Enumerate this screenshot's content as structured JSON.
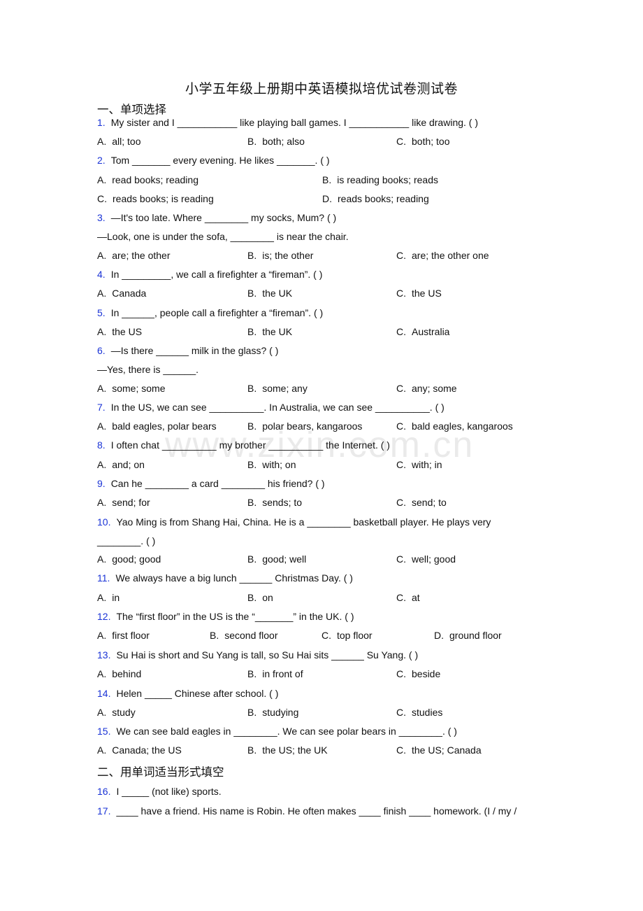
{
  "title": "小学五年级上册期中英语模拟培优试卷测试卷",
  "watermark": "www.zixin.com.cn",
  "sections": [
    {
      "heading": "一、单项选择"
    },
    {
      "heading": "二、用单词适当形式填空"
    }
  ],
  "questions": [
    {
      "num": "1.",
      "lines": [
        "My sister and I ___________ like playing ball games. I ___________ like drawing. (    )"
      ],
      "options": [
        {
          "label": "A.",
          "text": "all; too"
        },
        {
          "label": "B.",
          "text": "both; also"
        },
        {
          "label": "C.",
          "text": "both; too"
        }
      ]
    },
    {
      "num": "2.",
      "lines": [
        "Tom _______ every evening. He likes _______. (    )"
      ],
      "options": [
        {
          "label": "A.",
          "text": "read books; reading"
        },
        {
          "label": "B.",
          "text": "is reading books; reads"
        },
        {
          "label": "C.",
          "text": "reads books; is reading"
        },
        {
          "label": "D.",
          "text": "reads books; reading"
        }
      ]
    },
    {
      "num": "3.",
      "lines": [
        "—It's too late. Where ________ my socks, Mum? (        )",
        "—Look, one is under the sofa, ________ is near the chair."
      ],
      "options": [
        {
          "label": "A.",
          "text": "are; the other"
        },
        {
          "label": "B.",
          "text": "is; the other"
        },
        {
          "label": "C.",
          "text": "are; the other one"
        }
      ]
    },
    {
      "num": "4.",
      "lines": [
        "In _________, we call a firefighter a “fireman”. (    )"
      ],
      "options": [
        {
          "label": "A.",
          "text": "Canada"
        },
        {
          "label": "B.",
          "text": "the UK"
        },
        {
          "label": "C.",
          "text": "the US"
        }
      ]
    },
    {
      "num": "5.",
      "lines": [
        "In ______, people call a firefighter a “fireman”. (    )"
      ],
      "options": [
        {
          "label": "A.",
          "text": "the US"
        },
        {
          "label": "B.",
          "text": "the UK"
        },
        {
          "label": "C.",
          "text": "Australia"
        }
      ]
    },
    {
      "num": "6.",
      "lines": [
        "—Is there ______ milk in the glass? (    )",
        "—Yes, there is ______."
      ],
      "options": [
        {
          "label": "A.",
          "text": "some; some"
        },
        {
          "label": "B.",
          "text": "some; any"
        },
        {
          "label": "C.",
          "text": "any; some"
        }
      ]
    },
    {
      "num": "7.",
      "lines": [
        "In the US, we can see __________. In Australia, we can see __________. (    )"
      ],
      "options": [
        {
          "label": "A.",
          "text": "bald eagles, polar bears"
        },
        {
          "label": "B.",
          "text": "polar bears, kangaroos"
        },
        {
          "label": "C.",
          "text": "bald eagles, kangaroos"
        }
      ]
    },
    {
      "num": "8.",
      "lines": [
        "I often chat __________ my brother __________ the Internet. (    )"
      ],
      "options": [
        {
          "label": "A.",
          "text": "and; on"
        },
        {
          "label": "B.",
          "text": "with; on"
        },
        {
          "label": "C.",
          "text": "with; in"
        }
      ]
    },
    {
      "num": "9.",
      "lines": [
        "Can he ________ a card ________ his friend? (     )"
      ],
      "options": [
        {
          "label": "A.",
          "text": "send; for"
        },
        {
          "label": "B.",
          "text": "sends; to"
        },
        {
          "label": "C.",
          "text": "send; to"
        }
      ]
    },
    {
      "num": "10.",
      "lines": [
        "Yao Ming is from Shang Hai, China. He is a ________ basketball player. He plays very",
        "________. (     )"
      ],
      "options": [
        {
          "label": "A.",
          "text": "good; good"
        },
        {
          "label": "B.",
          "text": "good; well"
        },
        {
          "label": "C.",
          "text": "well; good"
        }
      ]
    },
    {
      "num": "11.",
      "lines": [
        "We always have a big lunch ______ Christmas Day. (    )"
      ],
      "options": [
        {
          "label": "A.",
          "text": "in"
        },
        {
          "label": "B.",
          "text": "on"
        },
        {
          "label": "C.",
          "text": "at"
        }
      ]
    },
    {
      "num": "12.",
      "lines": [
        "The “first floor” in the US is the “_______” in the UK. (    )"
      ],
      "options": [
        {
          "label": "A.",
          "text": "first floor"
        },
        {
          "label": "B.",
          "text": "second floor"
        },
        {
          "label": "C.",
          "text": "top floor"
        },
        {
          "label": "D.",
          "text": "ground floor"
        }
      ]
    },
    {
      "num": "13.",
      "lines": [
        "Su Hai is short and Su Yang is tall, so Su Hai sits ______ Su Yang. (    )"
      ],
      "options": [
        {
          "label": "A.",
          "text": "behind"
        },
        {
          "label": "B.",
          "text": "in front of"
        },
        {
          "label": "C.",
          "text": "beside"
        }
      ]
    },
    {
      "num": "14.",
      "lines": [
        "Helen _____ Chinese after school. (    )"
      ],
      "options": [
        {
          "label": "A.",
          "text": "study"
        },
        {
          "label": "B.",
          "text": "studying"
        },
        {
          "label": "C.",
          "text": "studies"
        }
      ]
    },
    {
      "num": "15.",
      "lines": [
        "We can see bald eagles in ________. We can see polar bears in ________. (    )"
      ],
      "options": [
        {
          "label": "A.",
          "text": "Canada; the US"
        },
        {
          "label": "B.",
          "text": "the US; the UK"
        },
        {
          "label": "C.",
          "text": "the US; Canada"
        }
      ]
    },
    {
      "num": "16.",
      "lines": [
        "I _____ (not like) sports."
      ],
      "options": []
    },
    {
      "num": "17.",
      "lines": [
        "____ have a friend. His name is Robin. He often makes ____ finish ____ homework. (I / my /"
      ],
      "options": []
    }
  ]
}
